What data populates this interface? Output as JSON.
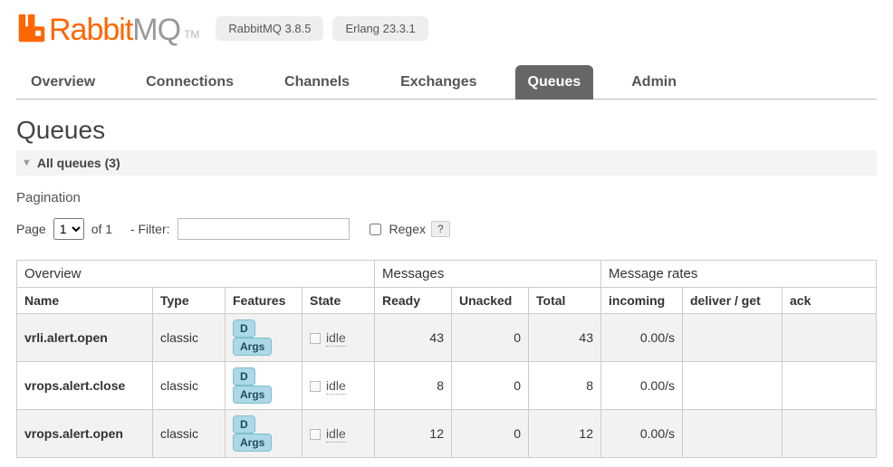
{
  "header": {
    "logo_text_a": "Rabbit",
    "logo_text_b": "MQ",
    "logo_tm": "TM",
    "version_badge": "RabbitMQ 3.8.5",
    "erlang_badge": "Erlang 23.3.1"
  },
  "nav": {
    "tabs": [
      "Overview",
      "Connections",
      "Channels",
      "Exchanges",
      "Queues",
      "Admin"
    ],
    "active": "Queues"
  },
  "page": {
    "title": "Queues",
    "section_label": "All queues (3)",
    "pagination_heading": "Pagination",
    "page_label": "Page",
    "page_options": [
      "1"
    ],
    "page_selected": "1",
    "of_label": "of 1",
    "filter_label": "- Filter:",
    "filter_value": "",
    "regex_label": "Regex",
    "regex_help": "?"
  },
  "table": {
    "groups": {
      "overview": "Overview",
      "messages": "Messages",
      "rates": "Message rates"
    },
    "columns": {
      "name": "Name",
      "type": "Type",
      "features": "Features",
      "state": "State",
      "ready": "Ready",
      "unacked": "Unacked",
      "total": "Total",
      "incoming": "incoming",
      "deliver_get": "deliver / get",
      "ack": "ack"
    },
    "feature_badges": {
      "d": "D",
      "args": "Args"
    },
    "rows": [
      {
        "name": "vrli.alert.open",
        "type": "classic",
        "state": "idle",
        "ready": "43",
        "unacked": "0",
        "total": "43",
        "incoming": "0.00/s",
        "deliver_get": "",
        "ack": ""
      },
      {
        "name": "vrops.alert.close",
        "type": "classic",
        "state": "idle",
        "ready": "8",
        "unacked": "0",
        "total": "8",
        "incoming": "0.00/s",
        "deliver_get": "",
        "ack": ""
      },
      {
        "name": "vrops.alert.open",
        "type": "classic",
        "state": "idle",
        "ready": "12",
        "unacked": "0",
        "total": "12",
        "incoming": "0.00/s",
        "deliver_get": "",
        "ack": ""
      }
    ]
  }
}
